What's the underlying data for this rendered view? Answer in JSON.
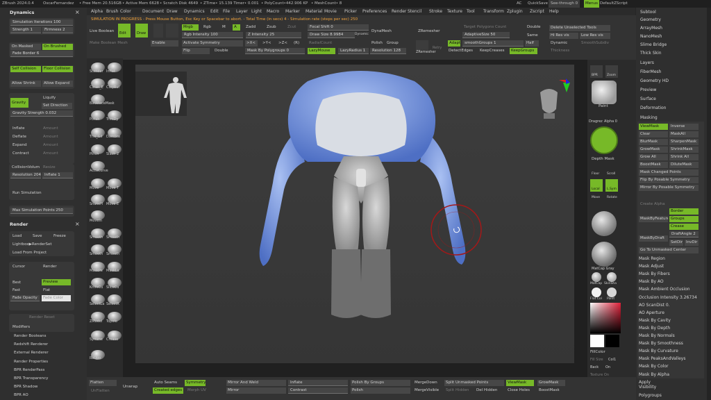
{
  "title_bar": {
    "app": "ZBrush 2024.0.4",
    "user": "OscarFernandez",
    "free_mem": "• Free Mem 20.516GB",
    "active_mem": "• Active Mem 6628",
    "scratch": "• Scratch Disk 4649",
    "ztime": "• ZTime• 15.139 Timer• 0.001",
    "polycount": "• PolyCount•442.906 KP",
    "meshcount": "• MeshCount• 8",
    "ac": "AC",
    "quicksave": "QuickSave",
    "see_through": "See-through  0",
    "menus": "Menus",
    "default_script": "DefaultZScript"
  },
  "menu": [
    "Alpha",
    "Brush",
    "Color",
    "Document",
    "Draw",
    "Dynamics",
    "Edit",
    "File",
    "Layer",
    "Light",
    "Macro",
    "Marker",
    "Material",
    "Movie",
    "Picker",
    "Preferences",
    "Render",
    "Stencil",
    "Stroke",
    "Texture",
    "Tool",
    "Transform",
    "Zplugin",
    "Zscript",
    "Help"
  ],
  "left_panel": {
    "dynamics_title": "Dynamics",
    "sim_iterations": "Simulation Iterations 100",
    "strength": "Strength 1",
    "firmness": "Firmness 2",
    "on_masked": "On Masked",
    "on_brushed": "On Brushed",
    "fade_border": "Fade Border 6",
    "self_collision": "Self Collision",
    "floor_collision": "Floor Collision",
    "allow_shrink": "Allow Shrink",
    "allow_expand": "Allow Expand",
    "gravity": "Gravity",
    "liquify": "Liquify",
    "set_direction": "Set Direction",
    "gravity_strength": "Gravity Strength 0.032",
    "inflate": "Inflate",
    "deflate": "Deflate",
    "expand": "Expand",
    "contract": "Contract",
    "amount": "Amount",
    "collision_volume": "CollisionVolum",
    "resize": "Resize",
    "resolution": "Resolution 204",
    "inflate_1": "Inflate 1",
    "run_simulation": "Run Simulation",
    "max_sim_points": "Max Simulation Points 250",
    "render_title": "Render",
    "load": "Load",
    "save": "Save",
    "freeze": "Freeze",
    "lightbox": "Lightbox▶RenderSet",
    "load_from_project": "Load From Project",
    "cursor": "Cursor",
    "render": "Render",
    "best": "Best",
    "preview": "Preview",
    "fast": "Fast",
    "flat": "Flat",
    "fade_opacity": "Fade Opacity",
    "fade_color": "Fade Color",
    "render_reset": "Render Reset",
    "modifiers": "Modifiers",
    "list": [
      "Render Booleans",
      "Redshift Renderer",
      "External Renderer",
      "Render Properties",
      "BPR RenderPass",
      "BPR Transparency",
      "BPR Shadow",
      "BPR AO"
    ]
  },
  "top_shelf": {
    "live_boolean": "Live Boolean",
    "make_boolean_mesh": "Make Boolean Mesh",
    "sim_progress": "SIMULATION IN PROGRESS - Press Mouse Button, Esc Key or Spacebar to abort. - Total Time (in secs) 4 - Simulation rate (steps per sec) 250",
    "edit": "Edit",
    "draw": "Draw",
    "mrgb": "Mrgb",
    "rgb": "Rgb",
    "m": "M",
    "a": "A",
    "zadd": "Zadd",
    "zsub": "Zsub",
    "zcut": "Zcut",
    "rgb_intensity": "Rgb Intensity 100",
    "z_intensity": "Z Intensity 25",
    "enable": "Enable",
    "activate_symmetry": "Activate Symmetry",
    "flip": "Flip",
    "double": "Double",
    "focal_shift": "Focal Shift 0",
    "draw_size": "Draw Size 8.9984",
    "dynamic": "Dynamic",
    "dynamesh": "DynaMesh",
    "radial_count": "RadialCount",
    "mask_by_polygroups": "Mask By Polygroups 0",
    "lazy_mouse": "LazyMouse",
    "lazy_radius": "LazyRadius 1",
    "polish": "Polish",
    "group": "Group",
    "resolution": "Resolution 128",
    "zremesher": "ZRemesher",
    "target_polygons": "Target Polygons Count",
    "adaptive_size": "AdaptiveSize 50",
    "adapt": "Adapt",
    "smooth_groups": "smoothGroups 1",
    "half": "Half",
    "detect_edges": "DetectEdges",
    "keep_creases": "KeepCreases",
    "keep_groups": "KeepGroups",
    "delete_unselected": "Delete Unselected Tools",
    "hi_res_vis": "Hi Res vis",
    "low_res_vis": "Low Res vis",
    "double2": "Double",
    "same": "Same",
    "dynamic2": "Dynamic",
    "smooth_subdiv": "SmoothSubdiv",
    "thickness": "Thickness",
    "retry": "Retry",
    "x": ">X<",
    "y": ">Y<",
    "z": ">Z<",
    "r": "(R)"
  },
  "tool_shelf": [
    "Standar",
    "Inflat",
    "Clean_E",
    "ClayBul",
    "BackfaceMask",
    "Polish",
    "TrimDy",
    "The_Gil",
    "DamSta",
    "Pinch",
    "Slash 2",
    "AccuCurve",
    "Move",
    "Move T",
    "SnakeH",
    "Move E",
    "MoveIn",
    "Smooth",
    "Smooth",
    "Smooth",
    "Smooth",
    "MaskPe",
    "MaskLa",
    "KnifeCu",
    "SliceCu",
    "SelectLa",
    "SelectR",
    "ZModel",
    "Topolo",
    "Symme",
    "Crease",
    "ReUpo"
  ],
  "right_shelf": {
    "bpr": "BPR",
    "zoom": "Zoom",
    "paint": "Paint",
    "dragrez": "Dragrez",
    "alpha": "Alpha 0",
    "depth_mask": "Depth Mask",
    "floor": "Floor",
    "scroll": "Scroll",
    "local": "Local",
    "lsym": "L.Sym",
    "move": "Move",
    "rotate": "Rotate",
    "matcap_gray": "MatCap Gray",
    "matcap": "MatCap",
    "skinshade": "SkinSha",
    "flat_color": "Flat Col",
    "paint2": "Paint",
    "fill_color": "FillColor",
    "fill_size": "Fill Size",
    "col1": "Col1",
    "back": "Back",
    "on": "On",
    "texture_on": "Texture On"
  },
  "right_panel": {
    "items": [
      "Subtool",
      "Geometry",
      "ArrayMesh",
      "NanoMesh",
      "Slime Bridge",
      "Thick Skin",
      "Layers",
      "FiberMesh",
      "Geometry HD",
      "Preview",
      "Surface",
      "Deformation",
      "Masking"
    ],
    "masking": {
      "viewmask": "ViewMask",
      "inverse": "Inverse",
      "clear": "Clear",
      "maskall": "MaskAll",
      "blurmask": "BlurMask",
      "sharpenmask": "SharpenMask",
      "growmask": "GrowMask",
      "shrinkmask": "ShrinkMask",
      "growall": "Grow All",
      "shrinkall": "Shrink All",
      "boostmask": "BoostMask",
      "dilutemask": "DiluteMask",
      "mask_changed_points": "Mask Changed Points",
      "flip_posable": "Flip By Posable Symmetry",
      "mirror_posable": "Mirror By Posable Symmetry",
      "create_alpha": "Create Alpha",
      "mask_by_feature": "MaskByFeature",
      "border": "Border",
      "groups": "Groups",
      "crease": "Crease",
      "mask_by_draft": "MaskByDraft",
      "draft_angle": "DraftAngle 2",
      "set_dir": "SetDir",
      "inv_dir": "InvDir",
      "go_unmasked": "Go To Unmasked Center",
      "list": [
        "Mask Region",
        "Mask Adjust",
        "Mask By Fibers",
        "Mask By AO",
        "Mask Ambient Occlusion",
        "Occlusion Intensity 3.26734",
        "AO ScanDist 0.",
        "AO Aperture",
        "Mask By Cavity",
        "Mask By Depth",
        "Mask By Normals",
        "Mask By Smoothness",
        "Mask By Curvature",
        "Mask PeaksAndValleys",
        "Mask By Color",
        "Mask By Alpha",
        "Apply"
      ],
      "visibility": "Visibility",
      "polygroups": "Polygroups"
    }
  },
  "bottom_shelf": {
    "flatten": "Flatten",
    "unflatten": "UnFlatten",
    "unwrap": "Unwrap",
    "auto_seams": "Auto Seams",
    "symmetry": "Symmetry",
    "created_edges": "Created edges",
    "morph_uv": "Morph UV",
    "mirror_and_weld": "Mirror And Weld",
    "mirror": "Mirror",
    "inflate": "Inflate",
    "contrast": "Contrast",
    "polish_by_groups": "Polish By Groups",
    "polish": "Polish",
    "merge_down": "MergeDown",
    "merge_visible": "MergeVisible",
    "split_unmasked": "Split Unmasked Points",
    "split_hidden": "Split Hidden",
    "del_hidden": "Del Hidden",
    "viewmask": "ViewMask",
    "close_holes": "Close Holes",
    "grow_mask": "GrowMask",
    "boost_mask": "BoostMask"
  },
  "colors": {
    "accent": "#77b928",
    "mask_blue": "#6f93df",
    "orange": "#f2a23a"
  }
}
